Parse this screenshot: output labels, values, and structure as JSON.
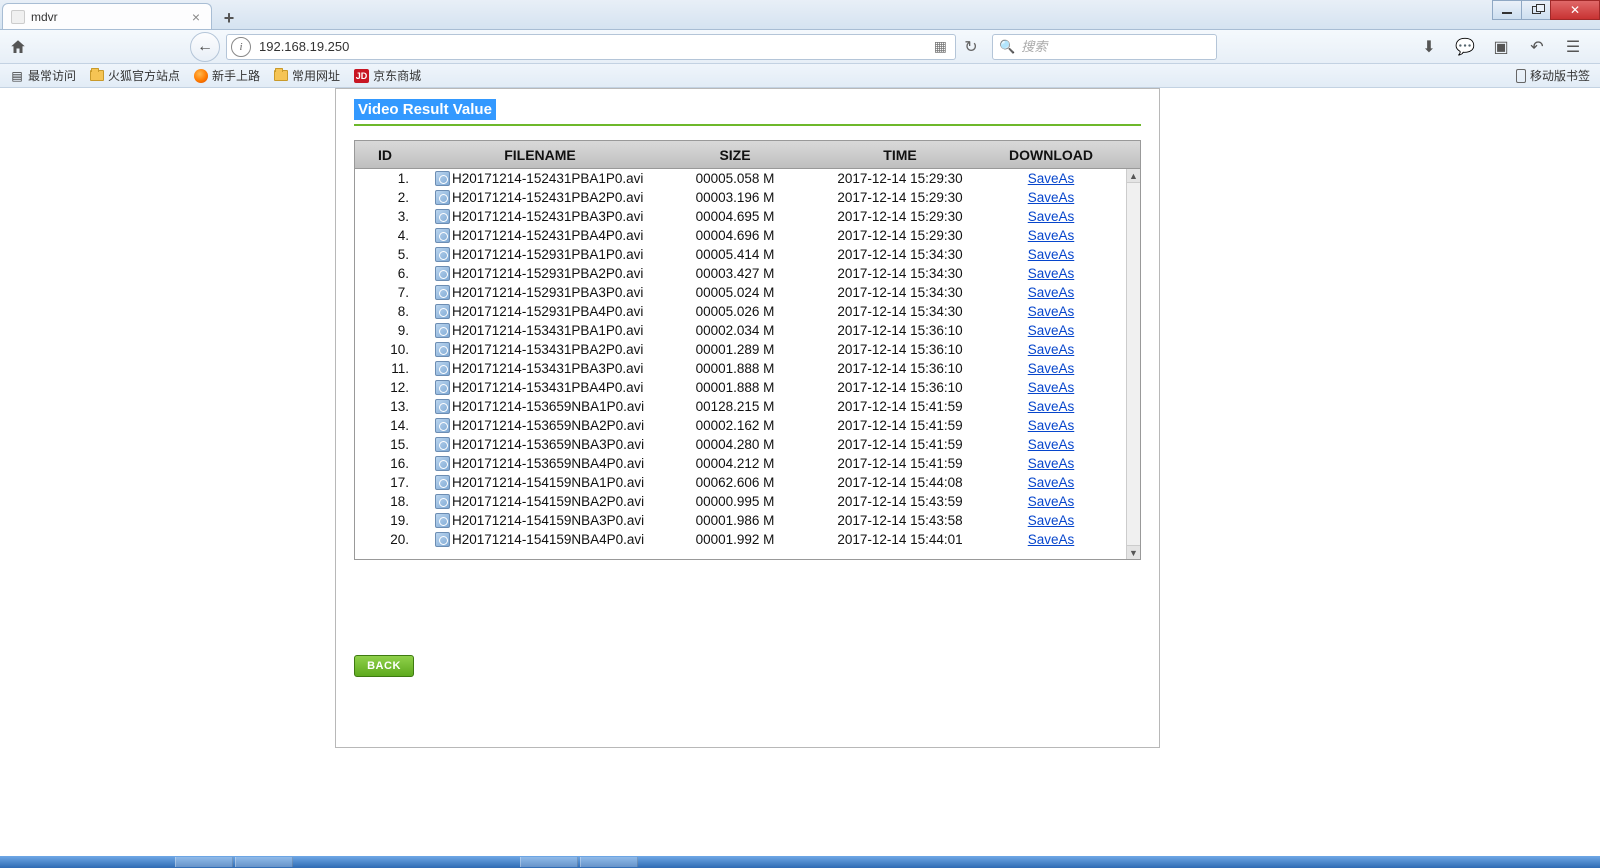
{
  "window": {
    "tab_title": "mdvr",
    "min_label": "minimize",
    "max_label": "restore",
    "close_label": "close"
  },
  "nav": {
    "address": "192.168.19.250",
    "search_placeholder": "搜索"
  },
  "bookmarks": {
    "most_visited": "最常访问",
    "ff_official": "火狐官方站点",
    "getting_started": "新手上路",
    "common_sites": "常用网址",
    "jd": "京东商城",
    "jd_badge": "JD",
    "mobile_bookmarks": "移动版书签"
  },
  "page": {
    "heading": "Video Result Value",
    "back_label": "BACK",
    "columns": {
      "id": "ID",
      "filename": "FILENAME",
      "size": "SIZE",
      "time": "TIME",
      "download": "DOWNLOAD"
    },
    "saveas_label": "SaveAs",
    "rows": [
      {
        "id": "1.",
        "filename": "H20171214-152431PBA1P0.avi",
        "size": "00005.058 M",
        "time": "2017-12-14 15:29:30"
      },
      {
        "id": "2.",
        "filename": "H20171214-152431PBA2P0.avi",
        "size": "00003.196 M",
        "time": "2017-12-14 15:29:30"
      },
      {
        "id": "3.",
        "filename": "H20171214-152431PBA3P0.avi",
        "size": "00004.695 M",
        "time": "2017-12-14 15:29:30"
      },
      {
        "id": "4.",
        "filename": "H20171214-152431PBA4P0.avi",
        "size": "00004.696 M",
        "time": "2017-12-14 15:29:30"
      },
      {
        "id": "5.",
        "filename": "H20171214-152931PBA1P0.avi",
        "size": "00005.414 M",
        "time": "2017-12-14 15:34:30"
      },
      {
        "id": "6.",
        "filename": "H20171214-152931PBA2P0.avi",
        "size": "00003.427 M",
        "time": "2017-12-14 15:34:30"
      },
      {
        "id": "7.",
        "filename": "H20171214-152931PBA3P0.avi",
        "size": "00005.024 M",
        "time": "2017-12-14 15:34:30"
      },
      {
        "id": "8.",
        "filename": "H20171214-152931PBA4P0.avi",
        "size": "00005.026 M",
        "time": "2017-12-14 15:34:30"
      },
      {
        "id": "9.",
        "filename": "H20171214-153431PBA1P0.avi",
        "size": "00002.034 M",
        "time": "2017-12-14 15:36:10"
      },
      {
        "id": "10.",
        "filename": "H20171214-153431PBA2P0.avi",
        "size": "00001.289 M",
        "time": "2017-12-14 15:36:10"
      },
      {
        "id": "11.",
        "filename": "H20171214-153431PBA3P0.avi",
        "size": "00001.888 M",
        "time": "2017-12-14 15:36:10"
      },
      {
        "id": "12.",
        "filename": "H20171214-153431PBA4P0.avi",
        "size": "00001.888 M",
        "time": "2017-12-14 15:36:10"
      },
      {
        "id": "13.",
        "filename": "H20171214-153659NBA1P0.avi",
        "size": "00128.215 M",
        "time": "2017-12-14 15:41:59"
      },
      {
        "id": "14.",
        "filename": "H20171214-153659NBA2P0.avi",
        "size": "00002.162 M",
        "time": "2017-12-14 15:41:59"
      },
      {
        "id": "15.",
        "filename": "H20171214-153659NBA3P0.avi",
        "size": "00004.280 M",
        "time": "2017-12-14 15:41:59"
      },
      {
        "id": "16.",
        "filename": "H20171214-153659NBA4P0.avi",
        "size": "00004.212 M",
        "time": "2017-12-14 15:41:59"
      },
      {
        "id": "17.",
        "filename": "H20171214-154159NBA1P0.avi",
        "size": "00062.606 M",
        "time": "2017-12-14 15:44:08"
      },
      {
        "id": "18.",
        "filename": "H20171214-154159NBA2P0.avi",
        "size": "00000.995 M",
        "time": "2017-12-14 15:43:59"
      },
      {
        "id": "19.",
        "filename": "H20171214-154159NBA3P0.avi",
        "size": "00001.986 M",
        "time": "2017-12-14 15:43:58"
      },
      {
        "id": "20.",
        "filename": "H20171214-154159NBA4P0.avi",
        "size": "00001.992 M",
        "time": "2017-12-14 15:44:01"
      }
    ]
  }
}
